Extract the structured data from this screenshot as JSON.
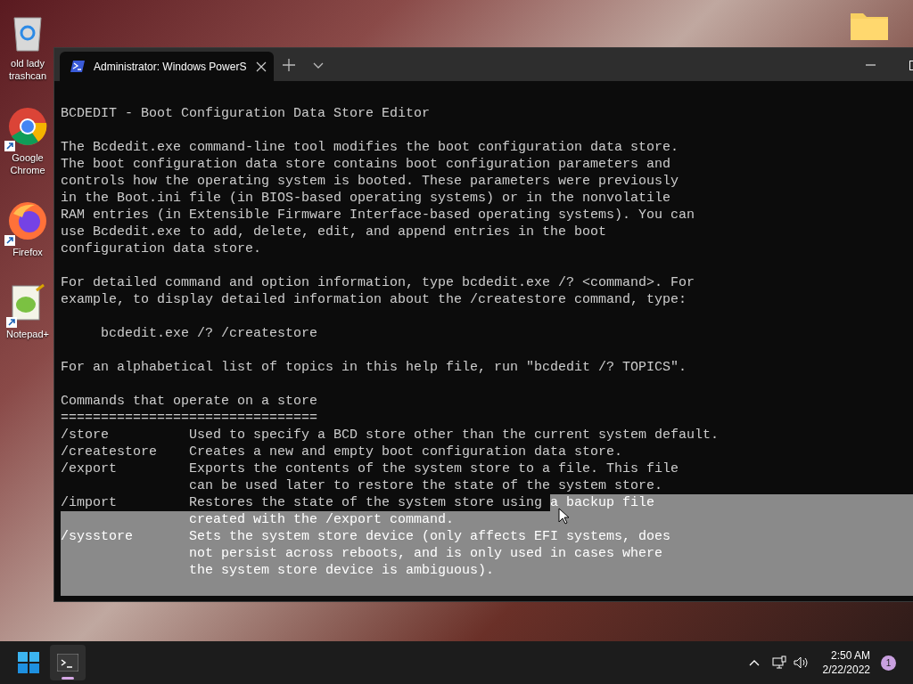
{
  "desktop_icons": [
    {
      "label": "old lady trashcan",
      "shortcut": false
    },
    {
      "label": "Google Chrome",
      "shortcut": true
    },
    {
      "label": "Firefox",
      "shortcut": true
    },
    {
      "label": "Notepad+",
      "shortcut": true
    }
  ],
  "window": {
    "tab_title": "Administrator: Windows PowerS",
    "lines": [
      {
        "selected": false
      },
      {
        "text": "BCDEDIT - Boot Configuration Data Store Editor",
        "selected": false
      },
      {
        "selected": false
      },
      {
        "text": "The Bcdedit.exe command-line tool modifies the boot configuration data store.",
        "selected": false
      },
      {
        "text": "The boot configuration data store contains boot configuration parameters and",
        "selected": false
      },
      {
        "text": "controls how the operating system is booted. These parameters were previously",
        "selected": false
      },
      {
        "text": "in the Boot.ini file (in BIOS-based operating systems) or in the nonvolatile",
        "selected": false
      },
      {
        "text": "RAM entries (in Extensible Firmware Interface-based operating systems). You can",
        "selected": false
      },
      {
        "text": "use Bcdedit.exe to add, delete, edit, and append entries in the boot",
        "selected": false
      },
      {
        "text": "configuration data store.",
        "selected": false
      },
      {
        "selected": false
      },
      {
        "text": "For detailed command and option information, type bcdedit.exe /? <command>. For",
        "selected": false
      },
      {
        "text": "example, to display detailed information about the /createstore command, type:",
        "selected": false
      },
      {
        "selected": false
      },
      {
        "text": "     bcdedit.exe /? /createstore",
        "selected": false
      },
      {
        "selected": false
      },
      {
        "text": "For an alphabetical list of topics in this help file, run \"bcdedit /? TOPICS\".",
        "selected": false
      },
      {
        "selected": false
      },
      {
        "text": "Commands that operate on a store",
        "selected": false
      },
      {
        "text": "================================",
        "selected": false
      },
      {
        "text": "/store          Used to specify a BCD store other than the current system default.",
        "selected": false
      },
      {
        "text": "/createstore    Creates a new and empty boot configuration data store.",
        "selected": false
      },
      {
        "text": "/export         Exports the contents of the system store to a file. This file",
        "selected": false
      },
      {
        "text": "                can be used later to restore the state of the system store.",
        "selected": false
      },
      {
        "segments": [
          {
            "text": "/import         Restores the state of the system store using ",
            "selected": false
          },
          {
            "text": "a backup file",
            "selected": true
          }
        ]
      },
      {
        "text": "                created with the /export command.",
        "selected": true
      },
      {
        "text": "/sysstore       Sets the system store device (only affects EFI systems, does",
        "selected": true
      },
      {
        "text": "                not persist across reboots, and is only used in cases where",
        "selected": true
      },
      {
        "text": "                the system store device is ambiguous).",
        "selected": true
      },
      {
        "selected": true
      }
    ]
  },
  "taskbar": {
    "apps": [
      {
        "kind": "start",
        "active": false
      },
      {
        "kind": "terminal",
        "active": true
      }
    ],
    "time": "2:50 AM",
    "date": "2/22/2022",
    "notification_count": "1"
  }
}
